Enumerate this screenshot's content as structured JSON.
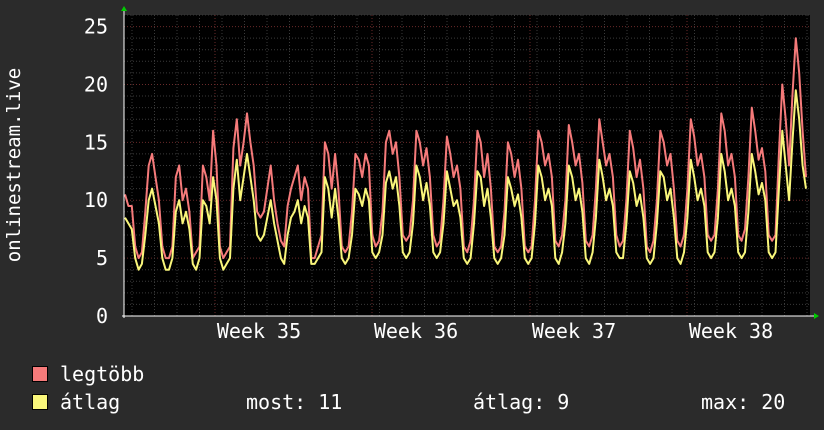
{
  "chart_data": {
    "type": "line",
    "ylabel": "onlinestream.live",
    "ylim": [
      0,
      26
    ],
    "yticks": [
      0,
      5,
      10,
      15,
      20,
      25
    ],
    "x_tick_labels": [
      "Week 35",
      "Week 36",
      "Week 37",
      "Week 38"
    ],
    "grid": true,
    "series": [
      {
        "name": "legtöbb",
        "color": "#f57a7a",
        "values": [
          10.5,
          9.5,
          9.5,
          6,
          5,
          5.5,
          9,
          13,
          14,
          12,
          10,
          6,
          5,
          5,
          6,
          12,
          13,
          10,
          11,
          9,
          5,
          5.5,
          6,
          13,
          12,
          10,
          16,
          13,
          6,
          5,
          5.5,
          6,
          14.5,
          17,
          13,
          15,
          17.5,
          15,
          13,
          9,
          8.5,
          9,
          11,
          13,
          10,
          8,
          6.5,
          6,
          9.5,
          11,
          12,
          13,
          10,
          12,
          11,
          5,
          5,
          6,
          7,
          15,
          14,
          11,
          14,
          11,
          6,
          5.5,
          6,
          9,
          14,
          13.5,
          12,
          14,
          13,
          7,
          6,
          6.5,
          9,
          15,
          16,
          14,
          15,
          12,
          7,
          6.5,
          7,
          10,
          16,
          15,
          13,
          14.5,
          12,
          7,
          6,
          6.5,
          10,
          15.5,
          14,
          12,
          13,
          11,
          6,
          5.5,
          6.5,
          10,
          16,
          15,
          12,
          14,
          11,
          6,
          5.5,
          6,
          9,
          15,
          14,
          12,
          13.5,
          11,
          6,
          5.5,
          6,
          10,
          16,
          15,
          13,
          14,
          12,
          6.5,
          6,
          7,
          10,
          16.5,
          15,
          13,
          14,
          11.5,
          6.5,
          6,
          7,
          11,
          17,
          15,
          13,
          14,
          12,
          7,
          6,
          6.5,
          10,
          16,
          14.5,
          12,
          13.5,
          11,
          6,
          5.5,
          6.5,
          10,
          16,
          15,
          13,
          14,
          11,
          6.5,
          6,
          7,
          11,
          17,
          15.5,
          13,
          14,
          12,
          7,
          6.5,
          7,
          11,
          17.5,
          16,
          13,
          14,
          12,
          7,
          6.5,
          7.5,
          12,
          18,
          16,
          13.5,
          14.5,
          12.5,
          7,
          6.5,
          7,
          14,
          20,
          17,
          13,
          19,
          24,
          21,
          16,
          12
        ]
      },
      {
        "name": "átlag",
        "color": "#f9f67a",
        "values": [
          8.5,
          8,
          7.5,
          5,
          4,
          4.5,
          7,
          10,
          11,
          9.5,
          8,
          5,
          4,
          4,
          5,
          9,
          10,
          8,
          9,
          7.5,
          4.5,
          4,
          5,
          10,
          9.5,
          8,
          12,
          10,
          5,
          4,
          4.5,
          5,
          11,
          13.5,
          10,
          12,
          14,
          12,
          10,
          7,
          6.5,
          7,
          8.5,
          10,
          8,
          6.5,
          5,
          4.5,
          7,
          8.5,
          9,
          10,
          8,
          9.5,
          8.5,
          4.5,
          4.5,
          5,
          5.5,
          12,
          11,
          8.5,
          11,
          8.5,
          5,
          4.5,
          5,
          7,
          11,
          10.5,
          9.5,
          11,
          10,
          5.5,
          5,
          5.5,
          7,
          11.5,
          12.5,
          11,
          12,
          9.5,
          5.5,
          5,
          5.5,
          8,
          13,
          12,
          10,
          11.5,
          9.5,
          5.5,
          5,
          5.5,
          8,
          12.5,
          11,
          9.5,
          10,
          8.5,
          5,
          4.5,
          5,
          8,
          12.5,
          12,
          9.5,
          11,
          8.5,
          5,
          4.5,
          5,
          7,
          12,
          11,
          9.5,
          10.5,
          8.5,
          5,
          4.5,
          5,
          8,
          13,
          12,
          10,
          11,
          9.5,
          5,
          4.5,
          5.5,
          8,
          13,
          12,
          10,
          11,
          9,
          5,
          4.5,
          5.5,
          8.5,
          13.5,
          12,
          10,
          11,
          9.5,
          5.5,
          5,
          5,
          8,
          12.5,
          11.5,
          9.5,
          10.5,
          8.5,
          5,
          4.5,
          5,
          8,
          12.5,
          12,
          10,
          11,
          8.5,
          5,
          4.5,
          5.5,
          8.5,
          13.5,
          12,
          10,
          11,
          9.5,
          5.5,
          5,
          5.5,
          8.5,
          14,
          12.5,
          10,
          11,
          9.5,
          5.5,
          5,
          5.5,
          9,
          14,
          12.5,
          10.5,
          11.5,
          10,
          5.5,
          5,
          5.5,
          11,
          16,
          13,
          10,
          15,
          19.5,
          17,
          13,
          11
        ]
      }
    ]
  },
  "legend": [
    {
      "label": "legtöbb",
      "color": "#f57a7a"
    },
    {
      "label": "átlag",
      "color": "#f9f67a"
    }
  ],
  "stats": {
    "now": "most: 11",
    "avg": "átlag: 9",
    "max": "max: 20"
  }
}
